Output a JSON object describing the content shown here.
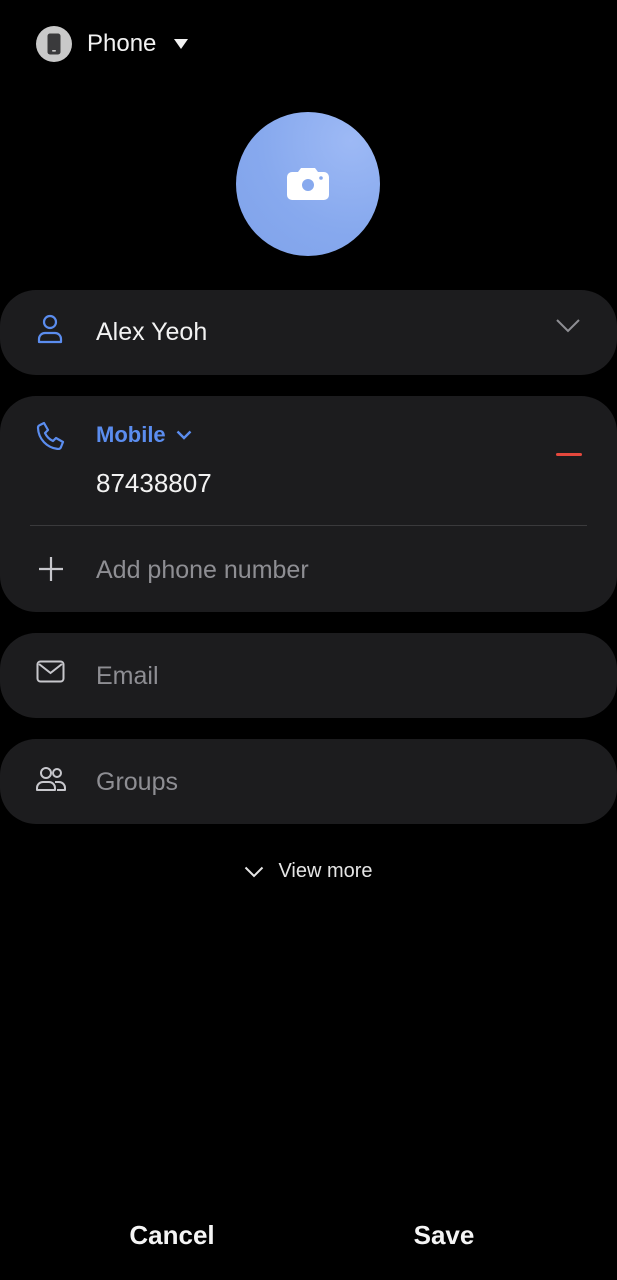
{
  "storage": {
    "label": "Phone",
    "icon": "phone-device-icon"
  },
  "photo": {
    "icon": "camera-icon",
    "color": "#87a9ee"
  },
  "name": {
    "value": "Alex Yeoh",
    "icon": "person-icon"
  },
  "phone": {
    "type": "Mobile",
    "number": "87438807",
    "add_label": "Add phone number",
    "accent": "#5b8def",
    "remove_color": "#e5483d"
  },
  "email": {
    "placeholder": "Email"
  },
  "groups": {
    "placeholder": "Groups"
  },
  "view_more": {
    "label": "View more"
  },
  "actions": {
    "cancel": "Cancel",
    "save": "Save"
  }
}
